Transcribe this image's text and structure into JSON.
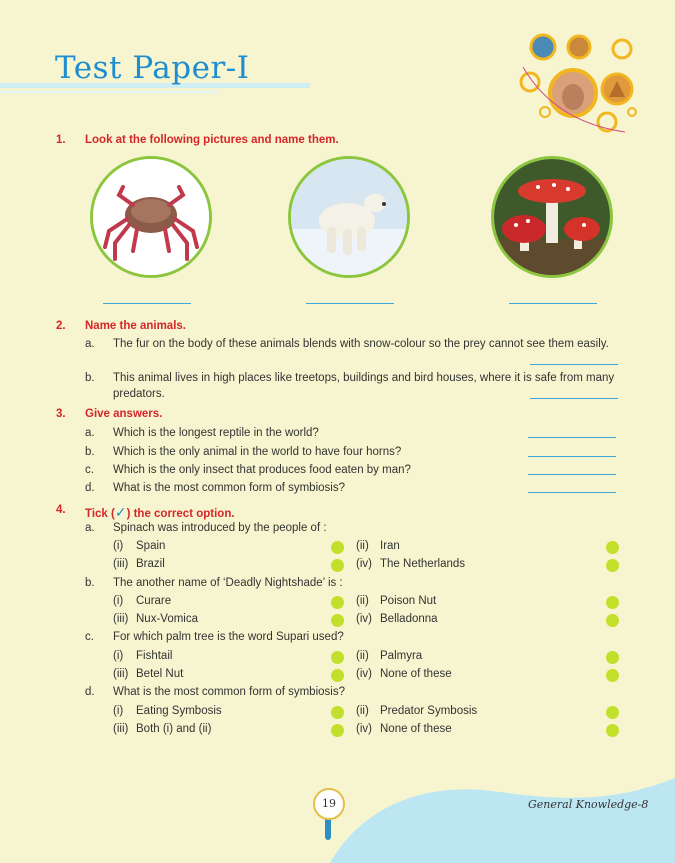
{
  "header": {
    "title": "Test Paper-I"
  },
  "q1": {
    "num": "1.",
    "title": "Look at the following pictures and name them.",
    "pictures": [
      "crab-icon",
      "polar-bear-icon",
      "mushroom-icon"
    ]
  },
  "q2": {
    "num": "2.",
    "title": "Name the animals.",
    "items": [
      {
        "letter": "a.",
        "text": "The fur on the body of these animals blends with snow-colour so the prey cannot see them easily."
      },
      {
        "letter": "b.",
        "text": "This animal lives in high places like treetops, buildings and bird houses, where it is safe from many",
        "text2": "predators."
      }
    ]
  },
  "q3": {
    "num": "3.",
    "title": "Give answers.",
    "items": [
      {
        "letter": "a.",
        "text": "Which is the longest reptile in the world?"
      },
      {
        "letter": "b.",
        "text": "Which is the only animal in the world to have four horns?"
      },
      {
        "letter": "c.",
        "text": "Which is the only insect that produces food eaten by man?"
      },
      {
        "letter": "d.",
        "text": "What is the most common form of symbiosis?"
      }
    ]
  },
  "q4": {
    "num": "4.",
    "title_pre": "Tick (",
    "tick": "✓",
    "title_post": ") the correct option.",
    "items": [
      {
        "letter": "a.",
        "text": "Spinach was introduced by the people of :",
        "options": [
          {
            "n": "(i)",
            "t": "Spain"
          },
          {
            "n": "(ii)",
            "t": "Iran"
          },
          {
            "n": "(iii)",
            "t": "Brazil"
          },
          {
            "n": "(iv)",
            "t": "The Netherlands"
          }
        ]
      },
      {
        "letter": "b.",
        "text": "The another name of ‘Deadly Nightshade’ is :",
        "options": [
          {
            "n": "(i)",
            "t": "Curare"
          },
          {
            "n": "(ii)",
            "t": "Poison Nut"
          },
          {
            "n": "(iii)",
            "t": "Nux-Vomica"
          },
          {
            "n": "(iv)",
            "t": "Belladonna"
          }
        ]
      },
      {
        "letter": "c.",
        "text": "For which palm tree is the word Supari used?",
        "options": [
          {
            "n": "(i)",
            "t": "Fishtail"
          },
          {
            "n": "(ii)",
            "t": "Palmyra"
          },
          {
            "n": "(iii)",
            "t": "Betel Nut"
          },
          {
            "n": "(iv)",
            "t": "None of these"
          }
        ]
      },
      {
        "letter": "d.",
        "text": "What is the most common form of symbiosis?",
        "options": [
          {
            "n": "(i)",
            "t": "Eating Symbosis"
          },
          {
            "n": "(ii)",
            "t": "Predator Symbosis"
          },
          {
            "n": "(iii)",
            "t": "Both (i) and (ii)"
          },
          {
            "n": "(iv)",
            "t": "None of these"
          }
        ]
      }
    ]
  },
  "footer": {
    "page": "19",
    "book": "General Knowledge-8"
  },
  "colors": {
    "accent": "#1f8ed0",
    "question": "#d6262a",
    "answer_line": "#3fa6da",
    "option_dot": "#c2df2c",
    "background": "#f6f5cf"
  }
}
